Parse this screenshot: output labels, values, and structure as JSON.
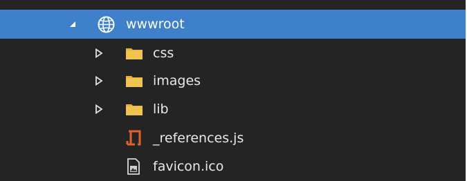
{
  "tree": {
    "root": {
      "label": "wwwroot",
      "expanded": true,
      "icon": "globe-icon",
      "selected": true
    },
    "items": [
      {
        "label": "css",
        "icon": "folder-icon",
        "expandable": true
      },
      {
        "label": "images",
        "icon": "folder-icon",
        "expandable": true
      },
      {
        "label": "lib",
        "icon": "folder-icon",
        "expandable": true
      },
      {
        "label": "_references.js",
        "icon": "js-file-icon",
        "expandable": false
      },
      {
        "label": "favicon.ico",
        "icon": "image-file-icon",
        "expandable": false
      }
    ]
  },
  "colors": {
    "selection": "#3e80c9",
    "background": "#242424",
    "folder": "#e8b13a",
    "js_icon": "#e0622e"
  }
}
